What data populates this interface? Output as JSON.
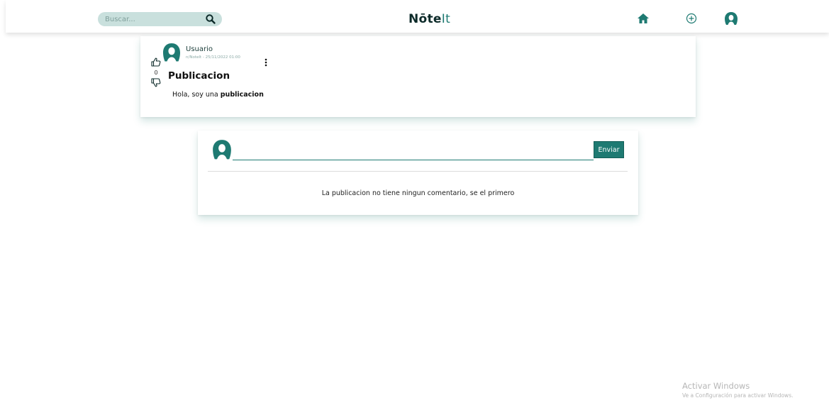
{
  "header": {
    "search_placeholder": "Buscar...",
    "logo_main": "Nōte",
    "logo_accent": "It",
    "icons": [
      "search-icon",
      "home-icon",
      "add-circle-icon",
      "profile-icon"
    ]
  },
  "post": {
    "username": "Usuario",
    "meta": "n/NoteIt - 25/11/2022 01:00",
    "vote_count": "0",
    "title": "Publicacion",
    "body_prefix": "Hola, soy una ",
    "body_bold": "publicacion"
  },
  "comments": {
    "input_placeholder": "",
    "send_label": "Enviar",
    "empty_message": "La publicacion no tiene ningun comentario, se el primero"
  },
  "watermark": {
    "title": "Activar Windows",
    "subtitle": "Ve a Configuración para activar Windows."
  },
  "colors": {
    "accent": "#1e7a72",
    "search_bg": "#c9e0dd"
  }
}
